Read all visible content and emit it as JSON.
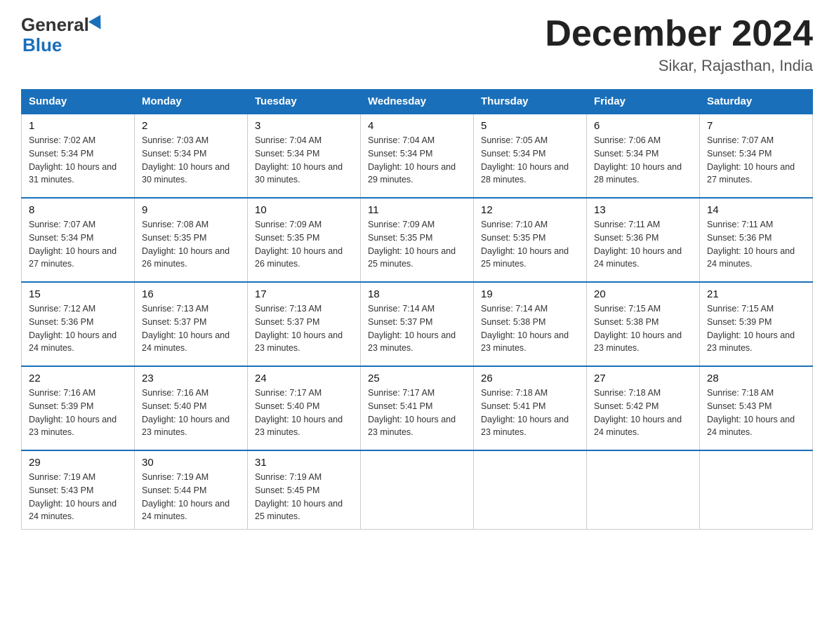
{
  "header": {
    "logo_general": "General",
    "logo_blue": "Blue",
    "month_title": "December 2024",
    "location": "Sikar, Rajasthan, India"
  },
  "days_of_week": [
    "Sunday",
    "Monday",
    "Tuesday",
    "Wednesday",
    "Thursday",
    "Friday",
    "Saturday"
  ],
  "weeks": [
    [
      {
        "day": "1",
        "sunrise": "7:02 AM",
        "sunset": "5:34 PM",
        "daylight": "10 hours and 31 minutes."
      },
      {
        "day": "2",
        "sunrise": "7:03 AM",
        "sunset": "5:34 PM",
        "daylight": "10 hours and 30 minutes."
      },
      {
        "day": "3",
        "sunrise": "7:04 AM",
        "sunset": "5:34 PM",
        "daylight": "10 hours and 30 minutes."
      },
      {
        "day": "4",
        "sunrise": "7:04 AM",
        "sunset": "5:34 PM",
        "daylight": "10 hours and 29 minutes."
      },
      {
        "day": "5",
        "sunrise": "7:05 AM",
        "sunset": "5:34 PM",
        "daylight": "10 hours and 28 minutes."
      },
      {
        "day": "6",
        "sunrise": "7:06 AM",
        "sunset": "5:34 PM",
        "daylight": "10 hours and 28 minutes."
      },
      {
        "day": "7",
        "sunrise": "7:07 AM",
        "sunset": "5:34 PM",
        "daylight": "10 hours and 27 minutes."
      }
    ],
    [
      {
        "day": "8",
        "sunrise": "7:07 AM",
        "sunset": "5:34 PM",
        "daylight": "10 hours and 27 minutes."
      },
      {
        "day": "9",
        "sunrise": "7:08 AM",
        "sunset": "5:35 PM",
        "daylight": "10 hours and 26 minutes."
      },
      {
        "day": "10",
        "sunrise": "7:09 AM",
        "sunset": "5:35 PM",
        "daylight": "10 hours and 26 minutes."
      },
      {
        "day": "11",
        "sunrise": "7:09 AM",
        "sunset": "5:35 PM",
        "daylight": "10 hours and 25 minutes."
      },
      {
        "day": "12",
        "sunrise": "7:10 AM",
        "sunset": "5:35 PM",
        "daylight": "10 hours and 25 minutes."
      },
      {
        "day": "13",
        "sunrise": "7:11 AM",
        "sunset": "5:36 PM",
        "daylight": "10 hours and 24 minutes."
      },
      {
        "day": "14",
        "sunrise": "7:11 AM",
        "sunset": "5:36 PM",
        "daylight": "10 hours and 24 minutes."
      }
    ],
    [
      {
        "day": "15",
        "sunrise": "7:12 AM",
        "sunset": "5:36 PM",
        "daylight": "10 hours and 24 minutes."
      },
      {
        "day": "16",
        "sunrise": "7:13 AM",
        "sunset": "5:37 PM",
        "daylight": "10 hours and 24 minutes."
      },
      {
        "day": "17",
        "sunrise": "7:13 AM",
        "sunset": "5:37 PM",
        "daylight": "10 hours and 23 minutes."
      },
      {
        "day": "18",
        "sunrise": "7:14 AM",
        "sunset": "5:37 PM",
        "daylight": "10 hours and 23 minutes."
      },
      {
        "day": "19",
        "sunrise": "7:14 AM",
        "sunset": "5:38 PM",
        "daylight": "10 hours and 23 minutes."
      },
      {
        "day": "20",
        "sunrise": "7:15 AM",
        "sunset": "5:38 PM",
        "daylight": "10 hours and 23 minutes."
      },
      {
        "day": "21",
        "sunrise": "7:15 AM",
        "sunset": "5:39 PM",
        "daylight": "10 hours and 23 minutes."
      }
    ],
    [
      {
        "day": "22",
        "sunrise": "7:16 AM",
        "sunset": "5:39 PM",
        "daylight": "10 hours and 23 minutes."
      },
      {
        "day": "23",
        "sunrise": "7:16 AM",
        "sunset": "5:40 PM",
        "daylight": "10 hours and 23 minutes."
      },
      {
        "day": "24",
        "sunrise": "7:17 AM",
        "sunset": "5:40 PM",
        "daylight": "10 hours and 23 minutes."
      },
      {
        "day": "25",
        "sunrise": "7:17 AM",
        "sunset": "5:41 PM",
        "daylight": "10 hours and 23 minutes."
      },
      {
        "day": "26",
        "sunrise": "7:18 AM",
        "sunset": "5:41 PM",
        "daylight": "10 hours and 23 minutes."
      },
      {
        "day": "27",
        "sunrise": "7:18 AM",
        "sunset": "5:42 PM",
        "daylight": "10 hours and 24 minutes."
      },
      {
        "day": "28",
        "sunrise": "7:18 AM",
        "sunset": "5:43 PM",
        "daylight": "10 hours and 24 minutes."
      }
    ],
    [
      {
        "day": "29",
        "sunrise": "7:19 AM",
        "sunset": "5:43 PM",
        "daylight": "10 hours and 24 minutes."
      },
      {
        "day": "30",
        "sunrise": "7:19 AM",
        "sunset": "5:44 PM",
        "daylight": "10 hours and 24 minutes."
      },
      {
        "day": "31",
        "sunrise": "7:19 AM",
        "sunset": "5:45 PM",
        "daylight": "10 hours and 25 minutes."
      },
      null,
      null,
      null,
      null
    ]
  ],
  "labels": {
    "sunrise_prefix": "Sunrise: ",
    "sunset_prefix": "Sunset: ",
    "daylight_prefix": "Daylight: "
  }
}
